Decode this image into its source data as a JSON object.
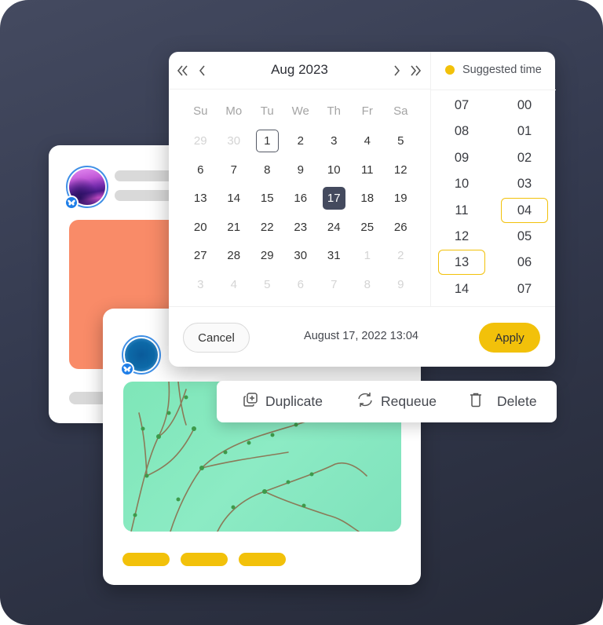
{
  "colors": {
    "accent": "#f2c10a",
    "selected_day": "#444a5e",
    "badge_blue": "#1e7ee8",
    "background_dark": "#343a4f"
  },
  "calendar": {
    "month_title": "Aug 2023",
    "nav": {
      "prev_year_icon": "double-chevron-left-icon",
      "prev_month_icon": "chevron-left-icon",
      "next_month_icon": "chevron-right-icon",
      "next_year_icon": "double-chevron-right-icon"
    },
    "weekdays": [
      "Su",
      "Mo",
      "Tu",
      "We",
      "Th",
      "Fr",
      "Sa"
    ],
    "weeks": [
      [
        {
          "d": "29",
          "muted": true
        },
        {
          "d": "30",
          "muted": true
        },
        {
          "d": "1",
          "today": true
        },
        {
          "d": "2"
        },
        {
          "d": "3"
        },
        {
          "d": "4"
        },
        {
          "d": "5"
        }
      ],
      [
        {
          "d": "6"
        },
        {
          "d": "7"
        },
        {
          "d": "8"
        },
        {
          "d": "9"
        },
        {
          "d": "10"
        },
        {
          "d": "11"
        },
        {
          "d": "12"
        }
      ],
      [
        {
          "d": "13"
        },
        {
          "d": "14"
        },
        {
          "d": "15"
        },
        {
          "d": "16"
        },
        {
          "d": "17",
          "selected": true
        },
        {
          "d": "18"
        },
        {
          "d": "19"
        }
      ],
      [
        {
          "d": "20"
        },
        {
          "d": "21"
        },
        {
          "d": "22"
        },
        {
          "d": "23"
        },
        {
          "d": "24"
        },
        {
          "d": "25"
        },
        {
          "d": "26"
        }
      ],
      [
        {
          "d": "27"
        },
        {
          "d": "28"
        },
        {
          "d": "29"
        },
        {
          "d": "30"
        },
        {
          "d": "31"
        },
        {
          "d": "1",
          "muted": true
        },
        {
          "d": "2",
          "muted": true
        }
      ],
      [
        {
          "d": "3",
          "muted": true
        },
        {
          "d": "4",
          "muted": true
        },
        {
          "d": "5",
          "muted": true
        },
        {
          "d": "6",
          "muted": true
        },
        {
          "d": "7",
          "muted": true
        },
        {
          "d": "8",
          "muted": true
        },
        {
          "d": "9",
          "muted": true
        }
      ]
    ]
  },
  "time_picker": {
    "suggested_label": "Suggested time",
    "hours": [
      "07",
      "08",
      "09",
      "10",
      "11",
      "12",
      "13",
      "14"
    ],
    "selected_hour": "13",
    "minutes": [
      "00",
      "01",
      "02",
      "03",
      "04",
      "05",
      "06",
      "07"
    ],
    "selected_minute": "04"
  },
  "footer": {
    "cancel_label": "Cancel",
    "selected_datetime": "August 17, 2022 13:04",
    "apply_label": "Apply"
  },
  "actions": [
    {
      "label": "Duplicate",
      "icon": "duplicate-icon"
    },
    {
      "label": "Requeue",
      "icon": "requeue-icon"
    },
    {
      "label": "Delete",
      "icon": "trash-icon"
    }
  ]
}
